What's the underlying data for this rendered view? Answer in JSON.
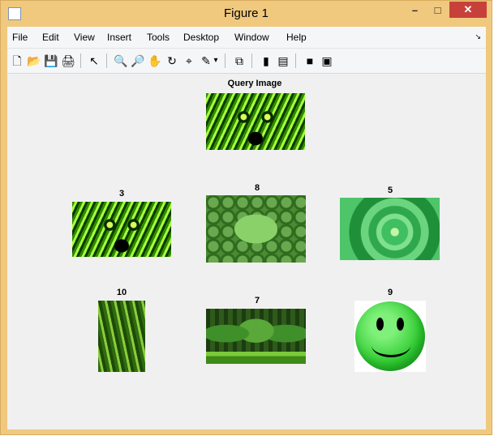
{
  "window": {
    "title": "Figure 1",
    "minimize_symbol": "–",
    "maximize_symbol": "□",
    "close_symbol": "✕"
  },
  "menu": {
    "items": [
      "File",
      "Edit",
      "View",
      "Insert",
      "Tools",
      "Desktop",
      "Window",
      "Help"
    ],
    "overflow_symbol": "↘"
  },
  "toolbar": {
    "buttons": [
      {
        "name": "new-figure-icon",
        "glyph": "🗋"
      },
      {
        "name": "open-file-icon",
        "glyph": "📂"
      },
      {
        "name": "save-icon",
        "glyph": "💾"
      },
      {
        "name": "print-icon",
        "glyph": "🖨"
      },
      {
        "name": "edit-plot-arrow-icon",
        "glyph": "↖"
      },
      {
        "name": "zoom-in-icon",
        "glyph": "🔍"
      },
      {
        "name": "zoom-out-icon",
        "glyph": "🔎"
      },
      {
        "name": "pan-hand-icon",
        "glyph": "✋"
      },
      {
        "name": "rotate-3d-icon",
        "glyph": "↻"
      },
      {
        "name": "data-cursor-icon",
        "glyph": "⌖"
      },
      {
        "name": "brush-icon",
        "glyph": "✎"
      },
      {
        "name": "brush-dropdown-icon",
        "glyph": "▾"
      },
      {
        "name": "link-plot-icon",
        "glyph": "⧉"
      },
      {
        "name": "colorbar-icon",
        "glyph": "▮"
      },
      {
        "name": "legend-icon",
        "glyph": "▤"
      },
      {
        "name": "hide-plot-tools-icon",
        "glyph": "■"
      },
      {
        "name": "show-plot-tools-icon",
        "glyph": "▣"
      }
    ]
  },
  "figure": {
    "query_title": "Query Image",
    "results": [
      {
        "label": "3",
        "image": "leopard"
      },
      {
        "label": "8",
        "image": "green-peas"
      },
      {
        "label": "5",
        "image": "green-rose"
      },
      {
        "label": "10",
        "image": "green-peppers"
      },
      {
        "label": "7",
        "image": "forest"
      },
      {
        "label": "9",
        "image": "smiley-face"
      }
    ]
  },
  "colors": {
    "titlebar": "#f0c97e",
    "close_button": "#c7403a",
    "figure_bg": "#f0f0f0"
  }
}
